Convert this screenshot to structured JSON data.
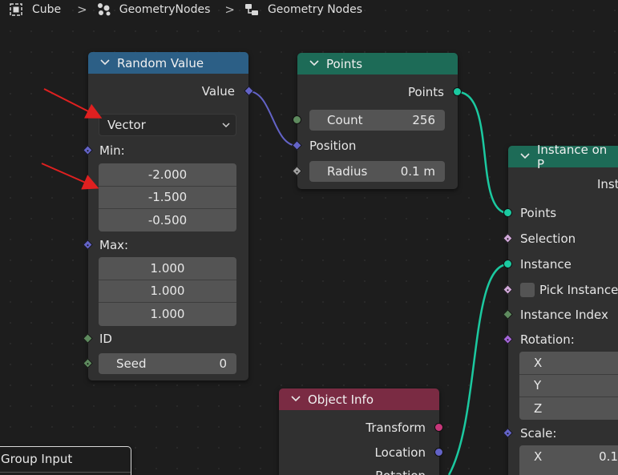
{
  "breadcrumb": {
    "items": [
      {
        "label": "Cube",
        "icon": "object-icon"
      },
      {
        "label": "GeometryNodes",
        "icon": "modifier-icon"
      },
      {
        "label": "Geometry Nodes",
        "icon": "node-tree-icon"
      }
    ],
    "separator": ">"
  },
  "nodes": {
    "random_value": {
      "title": "Random Value",
      "header_color": "#2c5f86",
      "output_value": "Value",
      "data_type": "Vector",
      "min_label": "Min:",
      "min": [
        "-2.000",
        "-1.500",
        "-0.500"
      ],
      "max_label": "Max:",
      "max": [
        "1.000",
        "1.000",
        "1.000"
      ],
      "id_label": "ID",
      "seed_label": "Seed",
      "seed_value": "0"
    },
    "points": {
      "title": "Points",
      "header_color": "#1d6b57",
      "output_points": "Points",
      "count_label": "Count",
      "count_value": "256",
      "position_label": "Position",
      "radius_label": "Radius",
      "radius_value": "0.1 m"
    },
    "instance_on_points": {
      "title": "Instance on P",
      "header_color": "#1d6b57",
      "output_instances": "Inst",
      "points_label": "Points",
      "selection_label": "Selection",
      "instance_label": "Instance",
      "pick_instance_label": "Pick Instance",
      "instance_index_label": "Instance Index",
      "rotation_label": "Rotation:",
      "rotation_axes": [
        "X",
        "Y",
        "Z"
      ],
      "scale_label": "Scale:",
      "scale_x_label": "X",
      "scale_x_value": "0.1"
    },
    "object_info": {
      "title": "Object Info",
      "header_color": "#7a2b43",
      "transform_label": "Transform",
      "location_label": "Location",
      "rotation_label": "Rotation"
    },
    "group_input": {
      "title": "Group Input"
    }
  },
  "colors": {
    "geometry_socket": "#1bc9a0",
    "vector_socket": "#6363c7",
    "float_socket": "#a1a1a1",
    "int_socket": "#5e8a5e",
    "matrix_socket": "#c7377a",
    "rotation_socket": "#a566d9",
    "annotation_arrow": "#e02020"
  }
}
